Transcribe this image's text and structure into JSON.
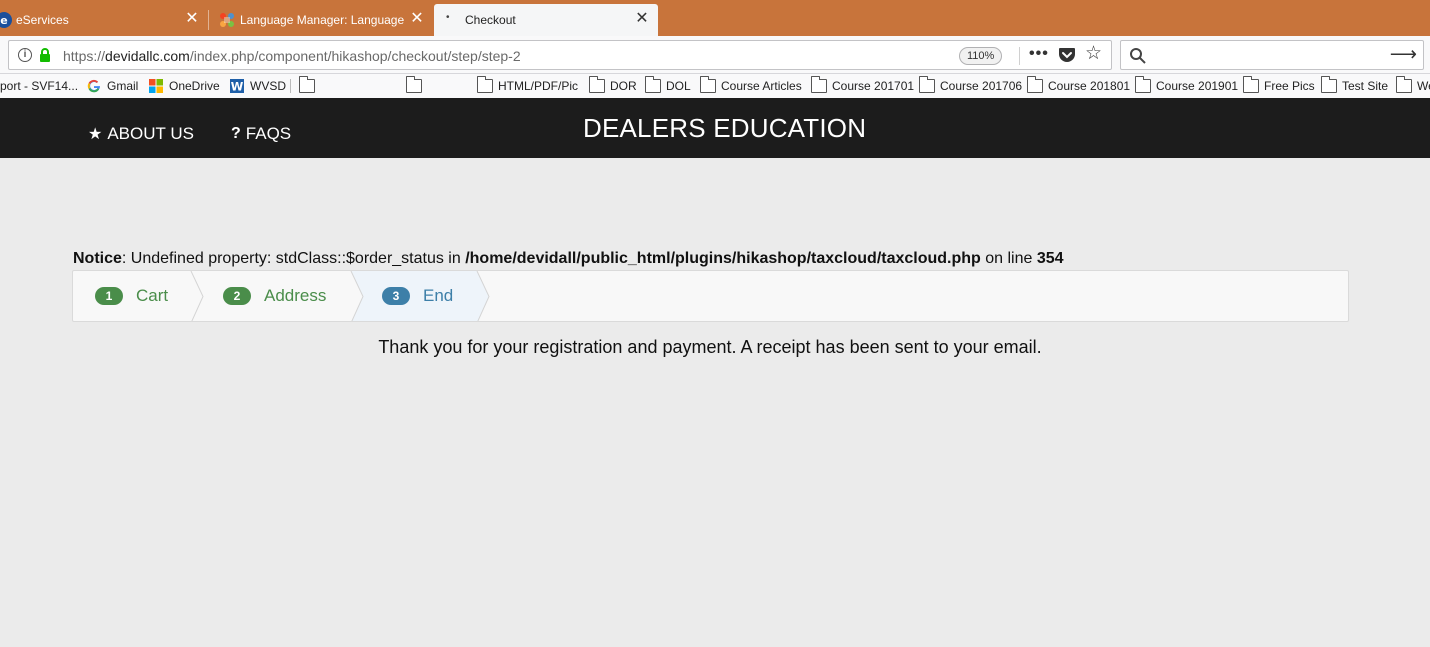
{
  "browser": {
    "tabs": [
      {
        "title": "eServices",
        "close": "✕"
      },
      {
        "title": "Language Manager: Language",
        "close": "✕"
      },
      {
        "title": "Checkout",
        "close": "✕"
      }
    ],
    "url": {
      "scheme": "https://",
      "host": "devidallc.com",
      "path": "/index.php/component/hikashop/checkout/step/step-2"
    },
    "zoom": "110%",
    "more_label": "•••",
    "search_placeholder": ""
  },
  "bookmarks": [
    {
      "label": "port - SVF14...",
      "icon": "none"
    },
    {
      "label": "Gmail",
      "icon": "google-icon"
    },
    {
      "label": "OneDrive",
      "icon": "microsoft-icon"
    },
    {
      "label": "WVSD",
      "icon": "w-icon"
    },
    {
      "label": "",
      "icon": "folder-icon"
    },
    {
      "label": "",
      "icon": "folder-icon"
    },
    {
      "label": "HTML/PDF/Pic",
      "icon": "folder-icon"
    },
    {
      "label": "DOR",
      "icon": "folder-icon"
    },
    {
      "label": "DOL",
      "icon": "folder-icon"
    },
    {
      "label": "Course Articles",
      "icon": "folder-icon"
    },
    {
      "label": "Course 201701",
      "icon": "folder-icon"
    },
    {
      "label": "Course 201706",
      "icon": "folder-icon"
    },
    {
      "label": "Course 201801",
      "icon": "folder-icon"
    },
    {
      "label": "Course 201901",
      "icon": "folder-icon"
    },
    {
      "label": "Free Pics",
      "icon": "folder-icon"
    },
    {
      "label": "Test Site",
      "icon": "folder-icon"
    },
    {
      "label": "We",
      "icon": "folder-icon"
    }
  ],
  "site": {
    "title": "DEALERS EDUCATION",
    "menu": [
      {
        "label": "ABOUT US",
        "icon": "★"
      },
      {
        "label": "FAQS",
        "icon": "?"
      }
    ]
  },
  "notice": {
    "label": "Notice",
    "message": ": Undefined property: stdClass::$order_status in ",
    "file": "/home/devidall/public_html/plugins/hikashop/taxcloud/taxcloud.php",
    "line_label": " on line ",
    "line": "354"
  },
  "checkout_steps": [
    {
      "number": "1",
      "label": "Cart",
      "state": "done"
    },
    {
      "number": "2",
      "label": "Address",
      "state": "done"
    },
    {
      "number": "3",
      "label": "End",
      "state": "active"
    }
  ],
  "colors": {
    "tab_bar": "#c8743b",
    "header": "#1c1c1c",
    "step_done": "#4a8d4a",
    "step_active": "#3d7fa8"
  },
  "confirmation": "Thank you for your registration and payment. A receipt has been sent to your email."
}
